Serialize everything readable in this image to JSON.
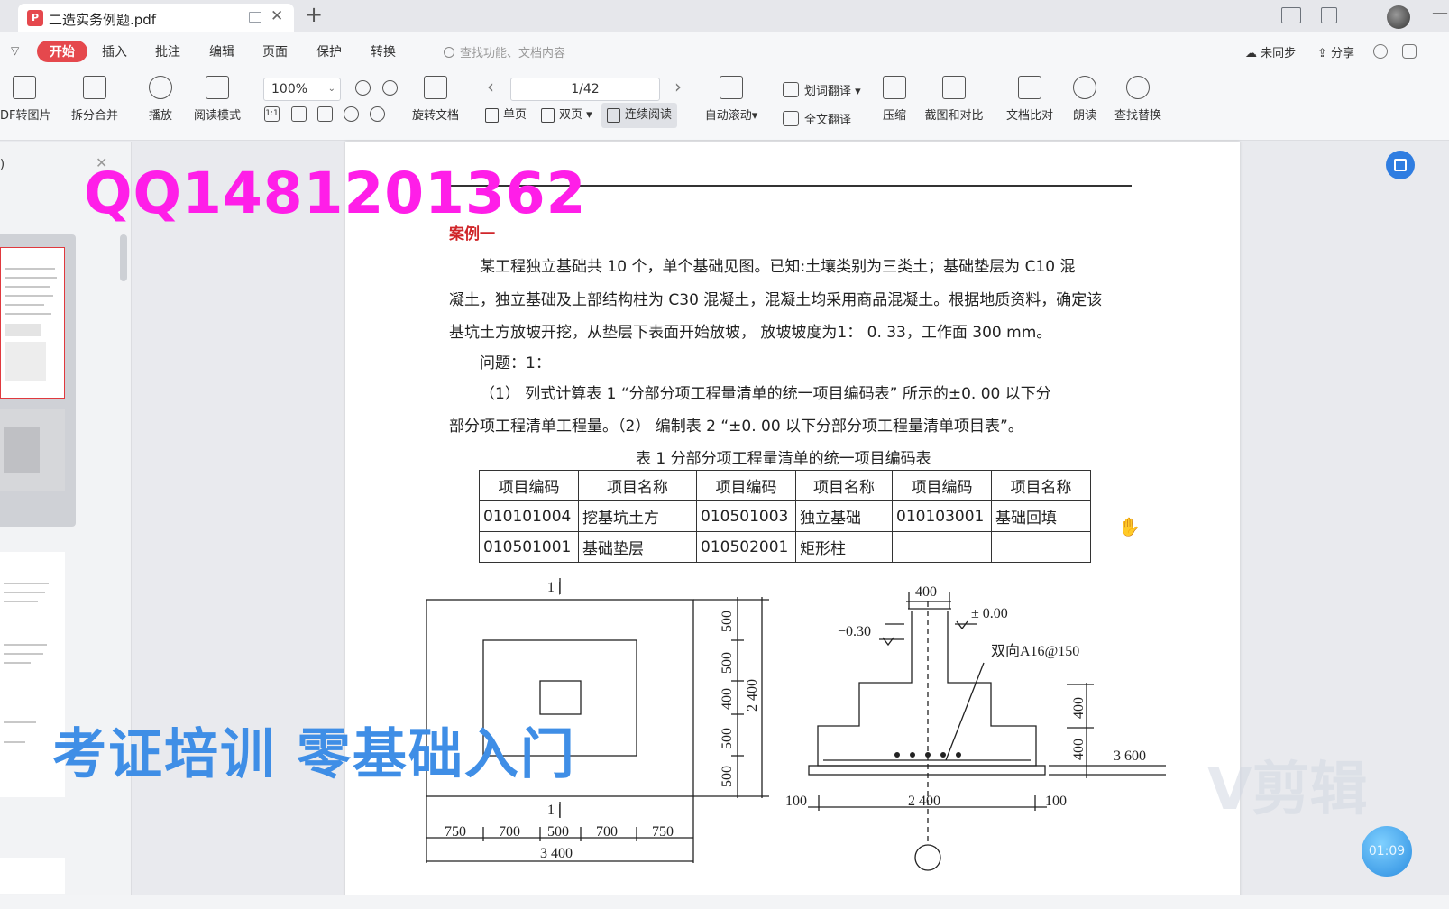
{
  "titlebar": {
    "doc_title": "二造实务例题.pdf",
    "pdf_badge": "P",
    "new_tab_label": "+"
  },
  "menu": {
    "items": [
      "开始",
      "插入",
      "批注",
      "编辑",
      "页面",
      "保护",
      "转换"
    ],
    "search_placeholder": "查找功能、文档内容",
    "sync": "未同步",
    "share": "分享"
  },
  "toolbar": {
    "pdf_to_image": "DF转图片",
    "split_merge": "拆分合并",
    "play": "播放",
    "read_mode": "阅读模式",
    "zoom": "100%",
    "actual_size": "1:1",
    "rotate_doc": "旋转文档",
    "page_indicator": "1/42",
    "single_page": "单页",
    "double_page": "双页",
    "continuous": "连续阅读",
    "auto_scroll": "自动滚动",
    "word_translate": "划词翻译",
    "full_translate": "全文翻译",
    "compress": "压缩",
    "screenshot_compare": "截图和对比",
    "doc_compare": "文档比对",
    "read_aloud": "朗读",
    "find_replace": "查找替换"
  },
  "leftpanel": {
    "header": ")"
  },
  "document": {
    "case_title": "案例一",
    "paragraph_lines": [
      "某工程独立基础共 10 个，单个基础见图。已知:土壤类别为三类土；基础垫层为 C10 混",
      "凝土，独立基础及上部结构柱为 C30 混凝土，混凝土均采用商品混凝土。根据地质资料，确定该",
      "基坑土方放坡开挖，从垫层下表面开始放坡，  放坡坡度为1：  0. 33，工作面 300  mm。",
      "问题：1：",
      "（1） 列式计算表 1 “分部分项工程量清单的统一项目编码表” 所示的±0. 00 以下分",
      "部分项工程清单工程量。（2） 编制表 2 “±0. 00 以下分部分项工程量清单项目表”。"
    ],
    "table_caption": "表 1   分部分项工程量清单的统一项目编码表",
    "table": {
      "headers": [
        "项目编码",
        "项目名称",
        "项目编码",
        "项目名称",
        "项目编码",
        "项目名称"
      ],
      "rows": [
        [
          "010101004",
          "挖基坑土方",
          "010501003",
          "独立基础",
          "010103001",
          "基础回填"
        ],
        [
          "010501001",
          "基础垫层",
          "010502001",
          "矩形柱",
          "",
          ""
        ]
      ]
    },
    "drawing_labels": {
      "section_mark_top": "1 |",
      "section_mark_bottom": "1 |",
      "dim_500_a": "500",
      "dim_500_b": "500",
      "dim_400": "400",
      "dim_500_c": "500",
      "dim_500_d": "500",
      "dim_2400_v": "2 400",
      "dim_750_a": "750",
      "dim_700_a": "700",
      "dim_500_h": "500",
      "dim_700_b": "700",
      "dim_750_b": "750",
      "dim_3400": "3 400",
      "sec_400_top": "400",
      "sec_pm000": "± 0.00",
      "sec_m030": "−0.30",
      "sec_rebar": "双向A16@150",
      "sec_400_right": "400",
      "sec_400_right2": "400",
      "sec_600": "3 600",
      "sec_100_left": "100",
      "sec_2400": "2 400",
      "sec_100_right": "100"
    }
  },
  "overlays": {
    "qq_text": "QQ1481201362",
    "cert_text": "考证培训  零基础入门",
    "jianji_text": "V剪辑",
    "timer": "01:09"
  }
}
